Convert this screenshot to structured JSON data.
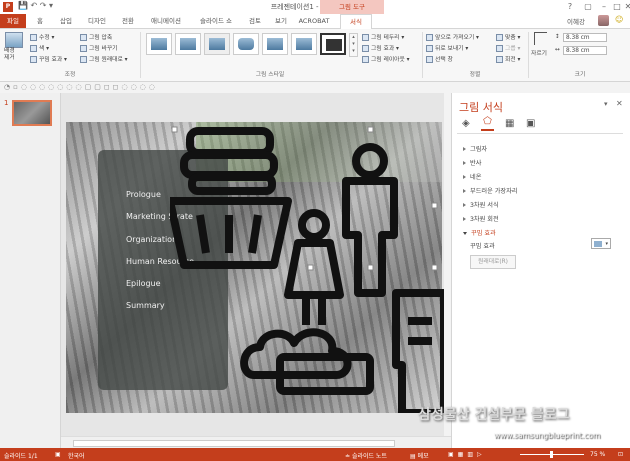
{
  "window": {
    "title": "프레젠테이션1 - PowerPoint",
    "contextual_tab": "그림 도구",
    "user": "이혜강",
    "controls": [
      "?",
      "▢",
      "–",
      "□",
      "✕"
    ]
  },
  "tabs": [
    {
      "label": "파일"
    },
    {
      "label": "홈"
    },
    {
      "label": "삽입"
    },
    {
      "label": "디자인"
    },
    {
      "label": "전환"
    },
    {
      "label": "애니메이션"
    },
    {
      "label": "슬라이드 쇼"
    },
    {
      "label": "검토"
    },
    {
      "label": "보기"
    },
    {
      "label": "ACROBAT"
    },
    {
      "label": "서식"
    }
  ],
  "ribbon": {
    "adjust": {
      "remove_bg": "배경\n제거",
      "correct": "수정",
      "color": "색",
      "artistic": "꾸밈 효과",
      "compress": "그림 압축",
      "change": "그림 바꾸기",
      "reset": "그림 원래대로",
      "label": "조정"
    },
    "styles": {
      "label": "그림 스타일"
    },
    "style_opts": {
      "border": "그림 테두리",
      "effects": "그림 효과",
      "layout": "그림 레이아웃"
    },
    "arrange": {
      "forward": "앞으로 가져오기",
      "backward": "뒤로 보내기",
      "selection": "선택 창",
      "align": "맞춤",
      "group": "그룹",
      "rotate": "회전",
      "label": "정렬"
    },
    "size": {
      "crop": "자르기",
      "height": "8.38 cm",
      "width": "8.38 cm",
      "label": "크기"
    }
  },
  "slide": {
    "number": "1",
    "menu": [
      "Prologue",
      "Marketing Strate",
      "Organization",
      "Human Resourse",
      "Epilogue",
      "Summary"
    ]
  },
  "format_pane": {
    "title": "그림 서식",
    "sections": [
      {
        "label": "그림자",
        "open": false
      },
      {
        "label": "반사",
        "open": false
      },
      {
        "label": "네온",
        "open": false
      },
      {
        "label": "부드러운 가장자리",
        "open": false
      },
      {
        "label": "3차원 서식",
        "open": false
      },
      {
        "label": "3차원 회전",
        "open": false
      },
      {
        "label": "꾸밈 효과",
        "open": true
      }
    ],
    "artistic_label": "꾸밈 효과",
    "reset_button": "원래대로(R)"
  },
  "status": {
    "slide": "슬라이드 1/1",
    "lang": "한국어",
    "notes": "슬라이드 노트",
    "comments": "메모",
    "zoom": "75 %"
  },
  "watermark": {
    "line1": "삼성물산 건설부문 블로그",
    "line2": "www.samsungblueprint.com"
  },
  "colors": {
    "accent": "#c43e1c",
    "contextual": "#f4c7c0"
  }
}
